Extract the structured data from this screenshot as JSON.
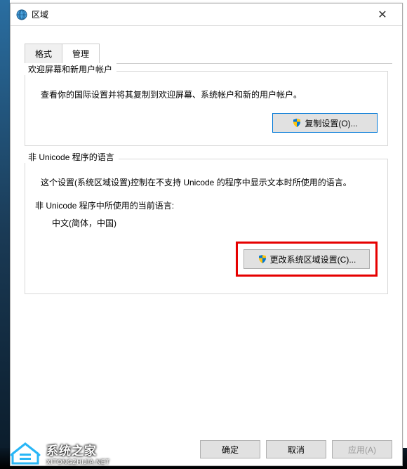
{
  "window": {
    "title": "区域"
  },
  "tabs": {
    "format": "格式",
    "admin": "管理"
  },
  "group1": {
    "title": "欢迎屏幕和新用户帐户",
    "desc": "查看你的国际设置并将其复制到欢迎屏幕、系统帐户和新的用户帐户。",
    "button": "复制设置(O)..."
  },
  "group2": {
    "title": "非 Unicode 程序的语言",
    "desc": "这个设置(系统区域设置)控制在不支持 Unicode 的程序中显示文本时所使用的语言。",
    "currentLabel": "非 Unicode 程序中所使用的当前语言:",
    "currentValue": "中文(简体，中国)",
    "button": "更改系统区域设置(C)..."
  },
  "footer": {
    "ok": "确定",
    "cancel": "取消",
    "apply": "应用(A)"
  },
  "watermark": {
    "title": "系统之家",
    "url": "XITONGZHIJIA.NET"
  }
}
